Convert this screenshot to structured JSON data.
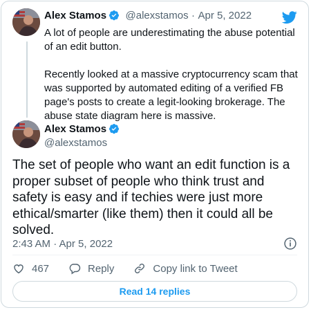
{
  "quoted_tweet": {
    "author_name": "Alex Stamos",
    "author_handle": "@alexstamos",
    "separator": "·",
    "date": "Apr 5, 2022",
    "paragraph1": "A lot of people are underestimating the abuse potential of an edit button.",
    "paragraph2": "Recently looked at a massive cryptocurrency scam that was supported by automated editing of a verified FB page's posts to create a legit-looking brokerage. The abuse state diagram here is massive."
  },
  "main_tweet": {
    "author_name": "Alex Stamos",
    "author_handle": "@alexstamos",
    "text": "The set of people who want an edit function is a proper subset of people who think trust and safety is easy and if techies were just more ethical/smarter (like them) then it could all be solved.",
    "timestamp": "2:43 AM · Apr 5, 2022"
  },
  "actions": {
    "like_count": "467",
    "reply_label": "Reply",
    "copy_link_label": "Copy link to Tweet"
  },
  "read_replies_label": "Read 14 replies",
  "colors": {
    "accent": "#1d9bf0",
    "muted": "#536471",
    "border": "#cfd9de"
  },
  "icons": [
    "twitter-bird-icon",
    "verified-badge-icon",
    "info-icon",
    "heart-icon",
    "reply-icon",
    "link-icon"
  ]
}
